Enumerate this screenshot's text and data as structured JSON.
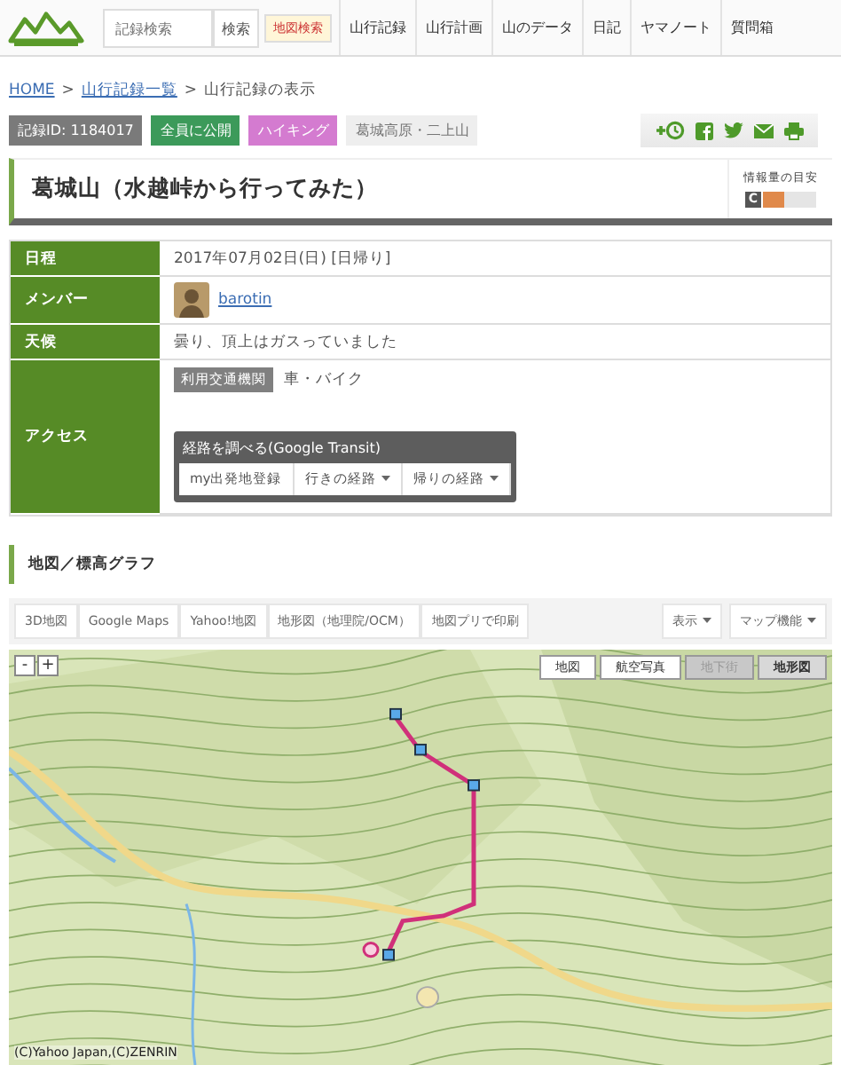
{
  "header": {
    "search": {
      "placeholder": "記録検索"
    },
    "search_button": "検索",
    "map_search_button": "地図検索",
    "nav": [
      {
        "label": "山行記録"
      },
      {
        "label": "山行計画"
      },
      {
        "label": "山のデータ"
      },
      {
        "label": "日記"
      },
      {
        "label": "ヤマノート"
      },
      {
        "label": "質問箱"
      }
    ]
  },
  "breadcrumb": [
    {
      "label": "HOME",
      "kind": "link"
    },
    {
      "label": "山行記録一覧",
      "kind": "link"
    },
    {
      "label": "山行記録の表示",
      "kind": "current"
    }
  ],
  "separator": ">",
  "tags": [
    {
      "label": "記録ID: 1184017",
      "color": "#7a7a7a"
    },
    {
      "label": "全員に公開",
      "color": "#3c9a5a"
    },
    {
      "label": "ハイキング",
      "color": "#d47bd0"
    },
    {
      "label": "葛城高原・二上山",
      "color": "#eeeeee"
    }
  ],
  "title": "葛城山（水越峠から行ってみた）",
  "info_meter": {
    "label": "情報量の目安",
    "grade": "C",
    "level": 0.4
  },
  "details": [
    {
      "label": "日程",
      "kind": "text",
      "value": "2017年07月02日(日) [日帰り]"
    },
    {
      "label": "メンバー",
      "kind": "member",
      "value": "barotin"
    },
    {
      "label": "天候",
      "kind": "text",
      "value": "曇り、頂上はガスっていました"
    },
    {
      "label": "アクセス",
      "kind": "access",
      "tag": "利用交通機関",
      "value": "車・バイク",
      "transit": {
        "title": "経路を調べる(Google Transit)",
        "buttons": [
          {
            "label": "my出発地登録",
            "dropdown": false
          },
          {
            "label": "行きの経路",
            "dropdown": true
          },
          {
            "label": "帰りの経路",
            "dropdown": true
          }
        ]
      }
    }
  ],
  "map_section": {
    "title": "地図／標高グラフ",
    "toolbar_left": [
      "3D地図",
      "Google Maps",
      "Yahoo!地図",
      "地形図（地理院/OCM）",
      "地図プリで印刷"
    ],
    "toolbar_right": [
      "表示",
      "マップ機能"
    ],
    "zoom_buttons": [
      "-",
      "+"
    ],
    "layers": [
      {
        "label": "地図",
        "selected": false,
        "disabled": false
      },
      {
        "label": "航空写真",
        "selected": false,
        "disabled": false
      },
      {
        "label": "地下街",
        "selected": false,
        "disabled": true
      },
      {
        "label": "地形図",
        "selected": true,
        "disabled": false
      }
    ],
    "copyright": "(C)Yahoo Japan,(C)ZENRIN"
  }
}
